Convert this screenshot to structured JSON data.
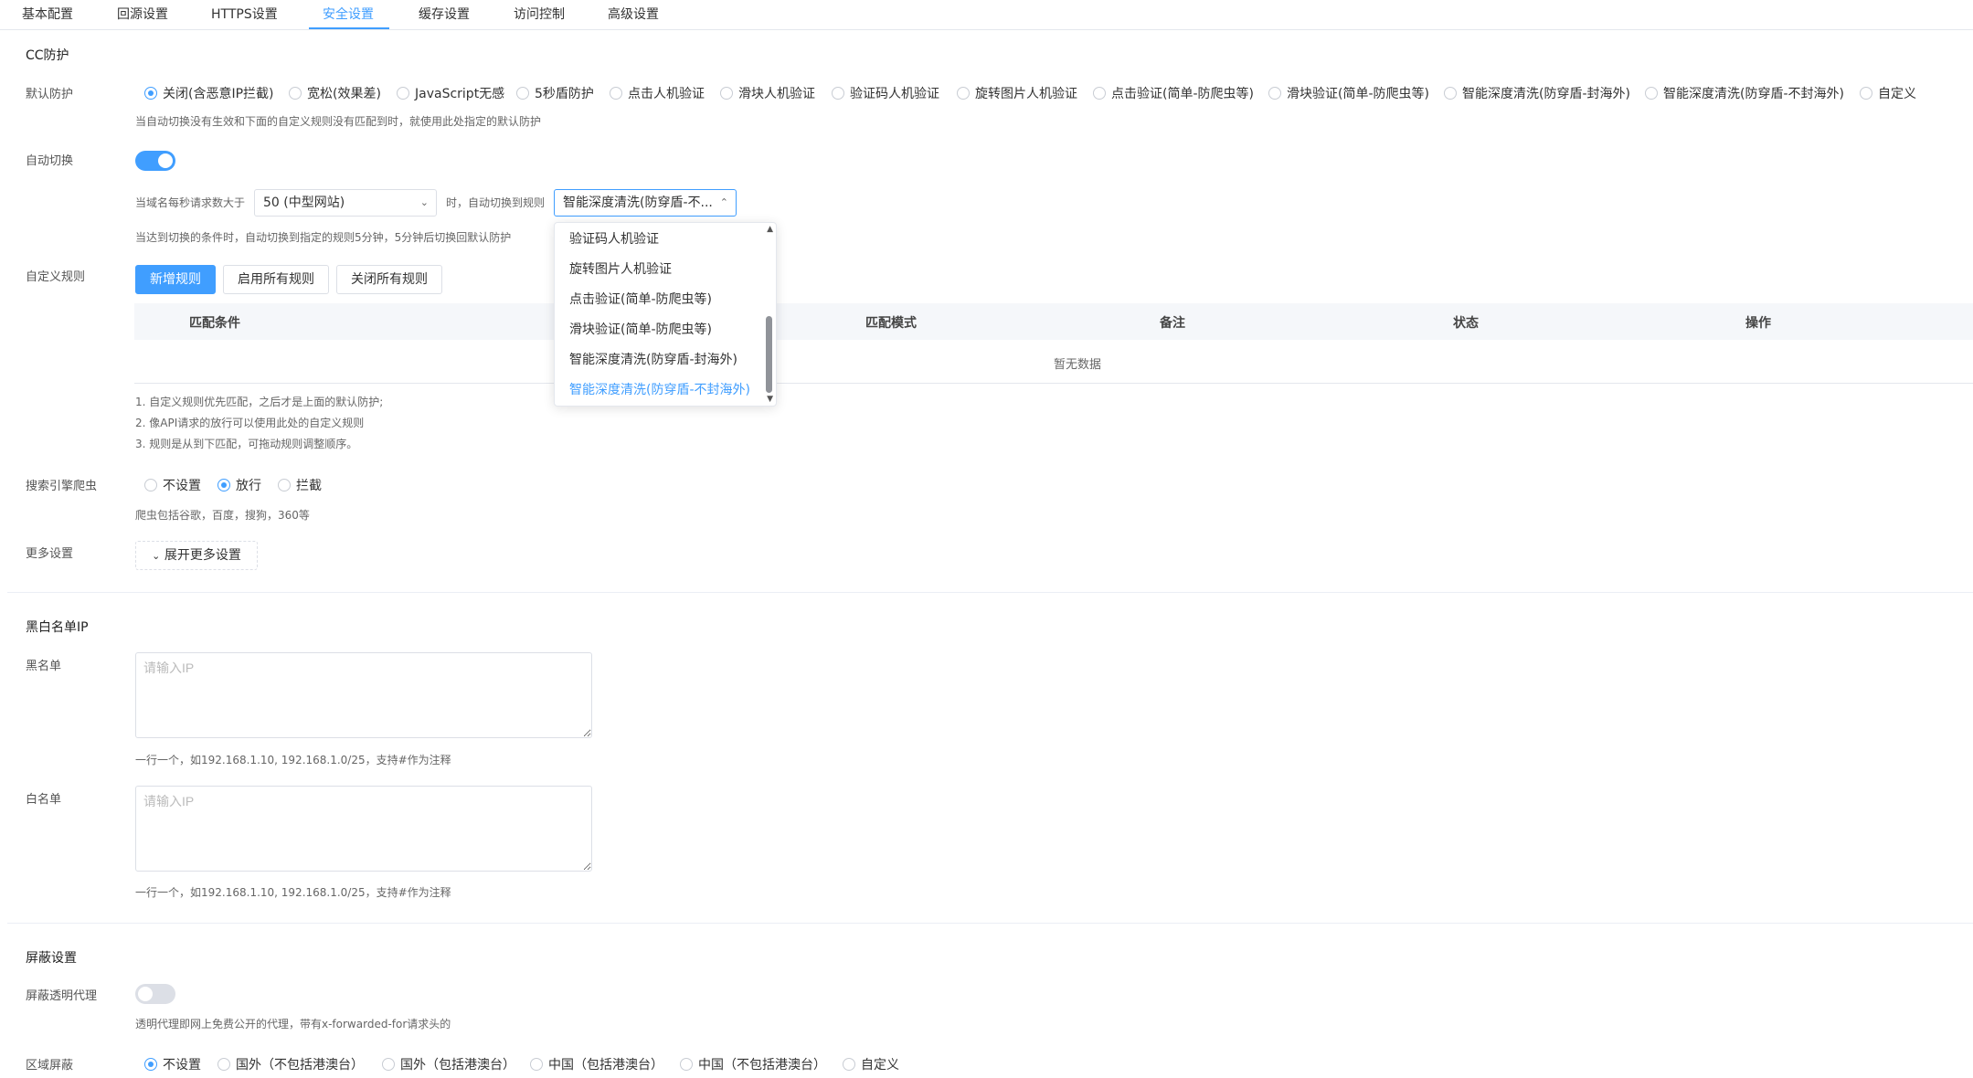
{
  "tabs": [
    {
      "label": "基本配置"
    },
    {
      "label": "回源设置"
    },
    {
      "label": "HTTPS设置"
    },
    {
      "label": "安全设置"
    },
    {
      "label": "缓存设置"
    },
    {
      "label": "访问控制"
    },
    {
      "label": "高级设置"
    }
  ],
  "active_tab": "安全设置",
  "cc": {
    "title": "CC防护",
    "default_label": "默认防护",
    "default_options": [
      {
        "label": "关闭(含恶意IP拦截)",
        "checked": true
      },
      {
        "label": "宽松(效果差)"
      },
      {
        "label": "JavaScript无感"
      },
      {
        "label": "5秒盾防护"
      },
      {
        "label": "点击人机验证"
      },
      {
        "label": "滑块人机验证"
      },
      {
        "label": "验证码人机验证"
      },
      {
        "label": "旋转图片人机验证"
      },
      {
        "label": "点击验证(简单-防爬虫等)"
      },
      {
        "label": "滑块验证(简单-防爬虫等)"
      },
      {
        "label": "智能深度清洗(防穿盾-封海外)"
      },
      {
        "label": "智能深度清洗(防穿盾-不封海外)"
      },
      {
        "label": "自定义"
      }
    ],
    "default_hint": "当自动切换没有生效和下面的自定义规则没有匹配到时，就使用此处指定的默认防护",
    "auto_label": "自动切换",
    "auto_on": true,
    "auto_prefix": "当域名每秒请求数大于",
    "auto_threshold": "50 (中型网站)",
    "auto_middle": "时，自动切换到规则",
    "auto_rule": "智能深度清洗(防穿盾-不...",
    "auto_hint": "当达到切换的条件时，自动切换到指定的规则5分钟，5分钟后切换回默认防护",
    "dropdown_items": [
      {
        "label": "验证码人机验证"
      },
      {
        "label": "旋转图片人机验证"
      },
      {
        "label": "点击验证(简单-防爬虫等)"
      },
      {
        "label": "滑块验证(简单-防爬虫等)"
      },
      {
        "label": "智能深度清洗(防穿盾-封海外)"
      },
      {
        "label": "智能深度清洗(防穿盾-不封海外)",
        "selected": true
      }
    ],
    "custom_label": "自定义规则",
    "btn_add": "新增规则",
    "btn_enable_all": "启用所有规则",
    "btn_disable_all": "关闭所有规则",
    "table_headers": [
      "匹配条件",
      "匹配模式",
      "备注",
      "状态",
      "操作"
    ],
    "table_empty": "暂无数据",
    "notes": [
      "1. 自定义规则优先匹配，之后才是上面的默认防护;",
      "2. 像API请求的放行可以使用此处的自定义规则",
      "3. 规则是从到下匹配，可拖动规则调整顺序。"
    ],
    "spider_label": "搜索引擎爬虫",
    "spider_options": [
      {
        "label": "不设置"
      },
      {
        "label": "放行",
        "checked": true
      },
      {
        "label": "拦截"
      }
    ],
    "spider_hint": "爬虫包括谷歌，百度，搜狗，360等",
    "more_label": "更多设置",
    "more_btn": "展开更多设置"
  },
  "ip": {
    "title": "黑白名单IP",
    "black_label": "黑名单",
    "black_placeholder": "请输入IP",
    "black_hint": "一行一个，如192.168.1.10, 192.168.1.0/25，支持#作为注释",
    "white_label": "白名单",
    "white_placeholder": "请输入IP",
    "white_hint": "一行一个，如192.168.1.10, 192.168.1.0/25，支持#作为注释"
  },
  "shield": {
    "title": "屏蔽设置",
    "proxy_label": "屏蔽透明代理",
    "proxy_on": false,
    "proxy_hint": "透明代理即网上免费公开的代理，带有x-forwarded-for请求头的",
    "region_label": "区域屏蔽",
    "region_options": [
      {
        "label": "不设置",
        "checked": true
      },
      {
        "label": "国外（不包括港澳台）"
      },
      {
        "label": "国外（包括港澳台）"
      },
      {
        "label": "中国（包括港澳台）"
      },
      {
        "label": "中国（不包括港澳台）"
      },
      {
        "label": "自定义"
      }
    ]
  },
  "colors": {
    "accent": "#409eff",
    "border": "#dcdfe6"
  }
}
